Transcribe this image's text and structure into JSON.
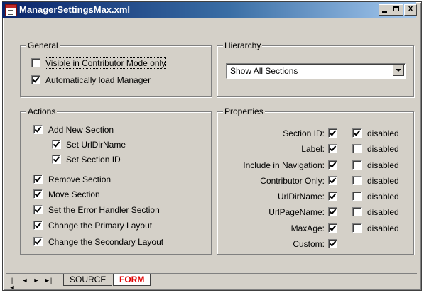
{
  "window": {
    "title": "ManagerSettingsMax.xml"
  },
  "controls": {
    "minimize": "_",
    "maximize": "□",
    "close": "X"
  },
  "general": {
    "legend": "General",
    "visible_contributor_only": {
      "label": "Visible in Contributor Mode only",
      "checked": false
    },
    "auto_load_manager": {
      "label": "Automatically load Manager",
      "checked": true
    }
  },
  "hierarchy": {
    "legend": "Hierarchy",
    "selected": "Show All Sections"
  },
  "actions": {
    "legend": "Actions",
    "items": [
      {
        "label": "Add New Section",
        "checked": true
      },
      {
        "label": "Set UrlDirName",
        "checked": true
      },
      {
        "label": "Set Section ID",
        "checked": true
      },
      {
        "label": "Remove Section",
        "checked": true
      },
      {
        "label": "Move Section",
        "checked": true
      },
      {
        "label": "Set the Error Handler Section",
        "checked": true
      },
      {
        "label": "Change the Primary Layout",
        "checked": true
      },
      {
        "label": "Change the Secondary Layout",
        "checked": true
      }
    ]
  },
  "properties": {
    "legend": "Properties",
    "disabled_label": "disabled",
    "rows": [
      {
        "label": "Section ID:",
        "checked": true,
        "disabled": true
      },
      {
        "label": "Label:",
        "checked": true,
        "disabled": false
      },
      {
        "label": "Include in Navigation:",
        "checked": true,
        "disabled": false
      },
      {
        "label": "Contributor Only:",
        "checked": true,
        "disabled": false
      },
      {
        "label": "UrlDirName:",
        "checked": true,
        "disabled": false
      },
      {
        "label": "UrlPageName:",
        "checked": true,
        "disabled": false
      },
      {
        "label": "MaxAge:",
        "checked": true,
        "disabled": false
      },
      {
        "label": "Custom:",
        "checked": true
      }
    ]
  },
  "tabs": {
    "nav": [
      "|◄",
      "◄",
      "►",
      "►|"
    ],
    "source": "SOURCE",
    "form": "FORM"
  }
}
